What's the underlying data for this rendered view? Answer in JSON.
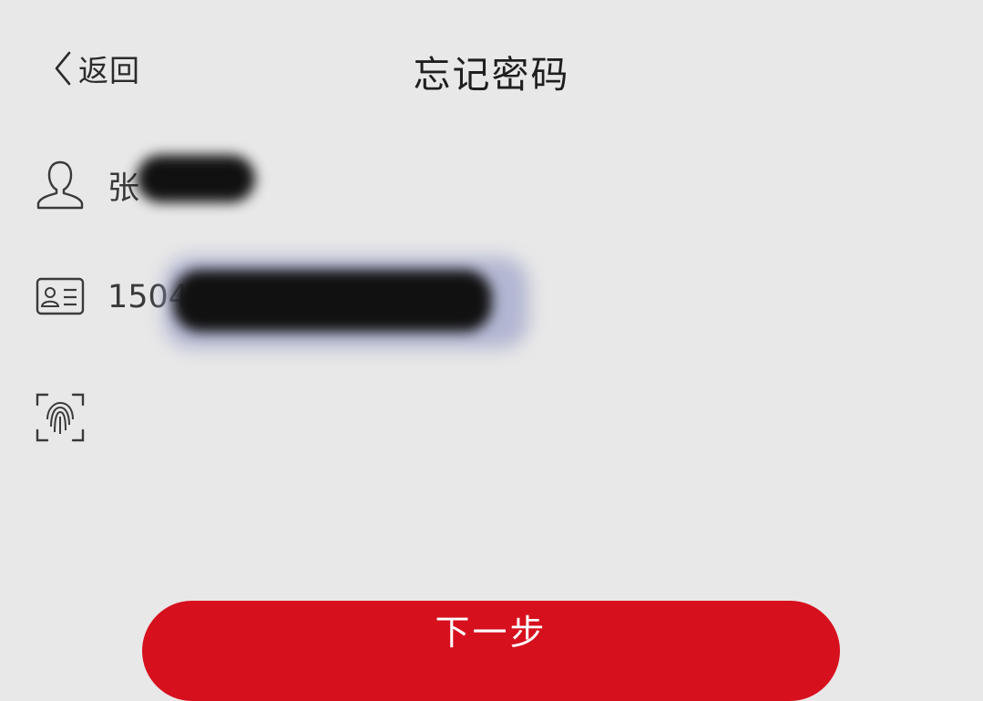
{
  "header": {
    "back_label": "返回",
    "title": "忘记密码"
  },
  "form": {
    "name_value": "张",
    "id_value": "1504",
    "code_placeholder": "",
    "next_label": "下一步"
  },
  "icons": {
    "back": "chevron-left-icon",
    "name": "user-icon",
    "id": "id-card-icon",
    "code": "fingerprint-scan-icon"
  },
  "colors": {
    "background": "#e8e8e8",
    "accent": "#d7101e",
    "text": "#2a2a2a",
    "button_text": "#ffffff"
  }
}
